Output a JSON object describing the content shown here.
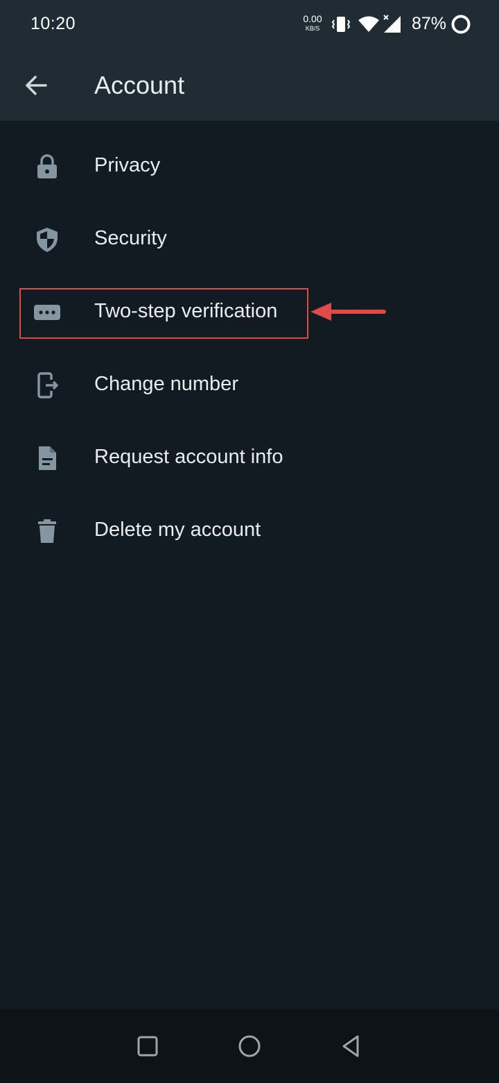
{
  "status_bar": {
    "time": "10:20",
    "net_speed_value": "0.00",
    "net_speed_unit": "KB/S",
    "battery": "87%",
    "icons": [
      "vibrate-icon",
      "wifi-icon",
      "cell-signal-icon",
      "battery-ring-icon"
    ]
  },
  "app_bar": {
    "title": "Account",
    "back_icon": "arrow-left-icon"
  },
  "menu": {
    "items": [
      {
        "label": "Privacy",
        "icon": "lock-icon"
      },
      {
        "label": "Security",
        "icon": "shield-icon"
      },
      {
        "label": "Two-step verification",
        "icon": "password-dots-icon"
      },
      {
        "label": "Change number",
        "icon": "phone-exit-icon"
      },
      {
        "label": "Request account info",
        "icon": "document-icon"
      },
      {
        "label": "Delete my account",
        "icon": "trash-icon"
      }
    ]
  },
  "annotation": {
    "highlighted_item": "Two-step verification",
    "color": "#E04B47"
  },
  "nav_bar": {
    "buttons": [
      "recents-square-icon",
      "home-circle-icon",
      "back-triangle-icon"
    ]
  },
  "colors": {
    "background": "#121B22",
    "bar": "#1F2C34",
    "icon": "#8696A0",
    "text": "#E9EDEF"
  }
}
